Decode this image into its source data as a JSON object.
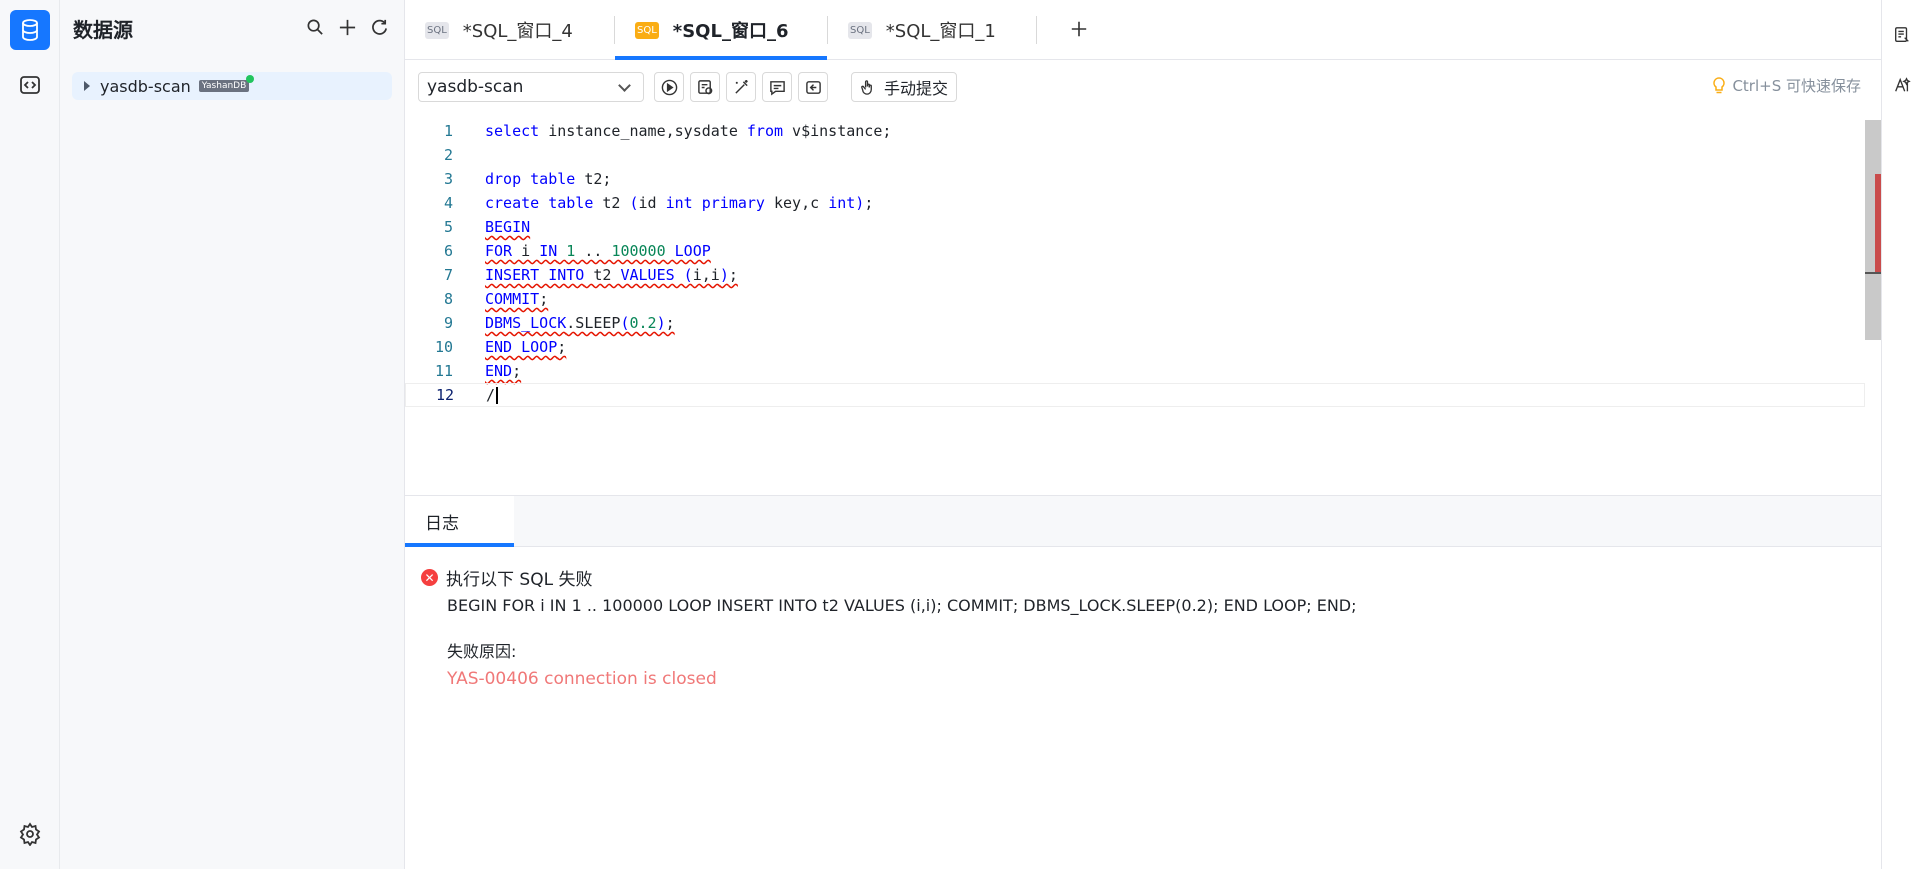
{
  "datasource": {
    "title": "数据源",
    "tree": [
      {
        "label": "yasdb-scan",
        "badge": "YashanDB",
        "status": "connected"
      }
    ]
  },
  "tabs": [
    {
      "label": "*SQL_窗口_4",
      "icon": "SQL",
      "active": false
    },
    {
      "label": "*SQL_窗口_6",
      "icon": "SQL",
      "active": true
    },
    {
      "label": "*SQL_窗口_1",
      "icon": "SQL",
      "active": false
    }
  ],
  "toolbar": {
    "connection": "yasdb-scan",
    "commit_mode": "手动提交",
    "save_hint": "Ctrl+S 可快速保存"
  },
  "editor": {
    "line_numbers": [
      "1",
      "2",
      "3",
      "4",
      "5",
      "6",
      "7",
      "8",
      "9",
      "10",
      "11",
      "12"
    ],
    "lines": [
      "select instance_name,sysdate from v$instance;",
      "",
      "drop table t2;",
      "create table t2 (id int primary key,c int);",
      "BEGIN",
      "FOR i IN 1 .. 100000 LOOP",
      "INSERT INTO t2 VALUES (i,i);",
      "COMMIT;",
      "DBMS_LOCK.SLEEP(0.2);",
      "END LOOP;",
      "END;",
      "/"
    ]
  },
  "log": {
    "tab_label": "日志",
    "status": "执行以下 SQL 失败",
    "sql": "BEGIN FOR i IN 1 .. 100000 LOOP INSERT INTO t2 VALUES (i,i); COMMIT; DBMS_LOCK.SLEEP(0.2); END LOOP; END;",
    "reason_label": "失败原因:",
    "reason": "YAS-00406 connection is closed"
  },
  "colors": {
    "accent": "#1677ff",
    "error": "#f53f3f",
    "error_text": "#f07878",
    "keyword": "#0000ff",
    "number": "#098658",
    "active_tab_icon": "#faad14"
  },
  "icons": {
    "activity": [
      "database-icon",
      "code-icon",
      "settings-icon"
    ],
    "datasource_tools": [
      "search-icon",
      "plus-icon",
      "refresh-icon"
    ],
    "toolbar": [
      "run-icon",
      "explain-icon",
      "format-icon",
      "snippet-icon",
      "history-icon",
      "hand-icon"
    ],
    "rail": [
      "notes-icon",
      "ai-icon"
    ]
  }
}
